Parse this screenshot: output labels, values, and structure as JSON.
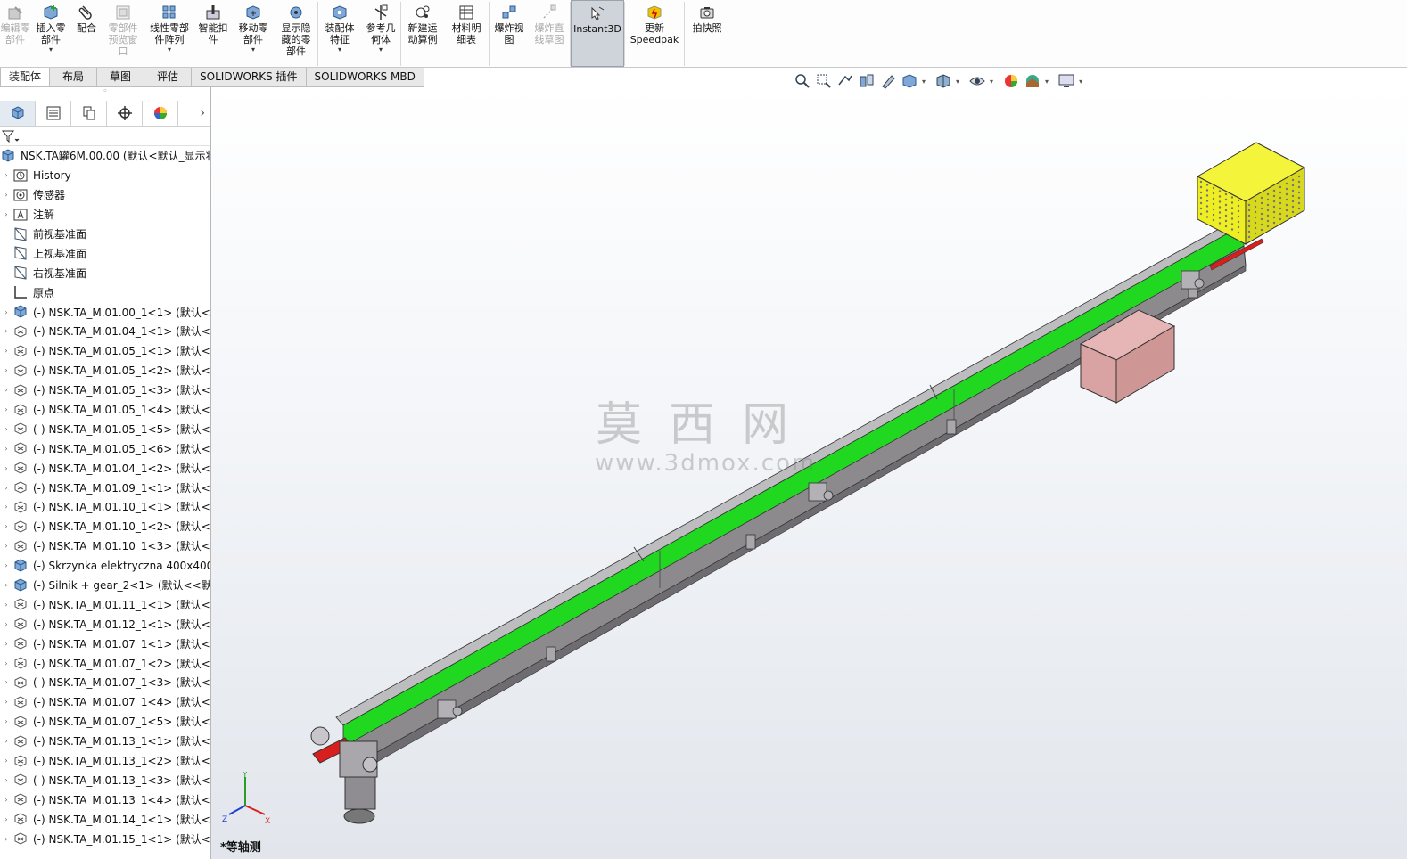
{
  "ribbon": {
    "buttons": [
      {
        "label": "编辑零\n部件",
        "icon": "edit-component-icon",
        "disabled": true,
        "dropdown": false
      },
      {
        "label": "插入零\n部件",
        "icon": "insert-component-icon",
        "disabled": false,
        "dropdown": true
      },
      {
        "label": "配合",
        "icon": "mate-icon",
        "disabled": false,
        "dropdown": false
      },
      {
        "label": "零部件\n预览窗\n口",
        "icon": "component-preview-icon",
        "disabled": true,
        "dropdown": false
      },
      {
        "label": "线性零部\n件阵列",
        "icon": "linear-pattern-icon",
        "disabled": false,
        "dropdown": true
      },
      {
        "label": "智能扣\n件",
        "icon": "smart-fasteners-icon",
        "disabled": false,
        "dropdown": false
      },
      {
        "label": "移动零\n部件",
        "icon": "move-component-icon",
        "disabled": false,
        "dropdown": true
      },
      {
        "label": "显示隐\n藏的零\n部件",
        "icon": "show-hidden-icon",
        "disabled": false,
        "dropdown": false
      },
      {
        "label": "装配体\n特征",
        "icon": "assembly-features-icon",
        "disabled": false,
        "dropdown": true
      },
      {
        "label": "参考几\n何体",
        "icon": "reference-geometry-icon",
        "disabled": false,
        "dropdown": true
      },
      {
        "label": "新建运\n动算例",
        "icon": "new-motion-study-icon",
        "disabled": false,
        "dropdown": false
      },
      {
        "label": "材料明\n细表",
        "icon": "bill-of-materials-icon",
        "disabled": false,
        "dropdown": false
      },
      {
        "label": "爆炸视\n图",
        "icon": "exploded-view-icon",
        "disabled": false,
        "dropdown": false
      },
      {
        "label": "爆炸直\n线草图",
        "icon": "explode-line-sketch-icon",
        "disabled": true,
        "dropdown": false
      },
      {
        "label": "Instant3D",
        "icon": "instant3d-icon",
        "disabled": false,
        "dropdown": false,
        "active": true
      },
      {
        "label": "更新\nSpeedpak",
        "icon": "speedpak-icon",
        "disabled": false,
        "dropdown": false
      },
      {
        "label": "拍快照",
        "icon": "snapshot-icon",
        "disabled": false,
        "dropdown": false
      }
    ]
  },
  "tabs": [
    "装配体",
    "布局",
    "草图",
    "评估",
    "SOLIDWORKS 插件",
    "SOLIDWORKS MBD"
  ],
  "hud_icons": [
    "zoom-to-fit-icon",
    "zoom-to-area-icon",
    "previous-view-icon",
    "section-view-icon",
    "dynamic-annotation-icon",
    "view-orientation-icon",
    "display-style-icon",
    "hide-show-icon",
    "edit-appearance-icon",
    "apply-scene-icon",
    "view-settings-icon"
  ],
  "tree": {
    "root": "NSK.TA罐6M.00.00  (默认<默认_显示状",
    "folders": [
      {
        "label": "History",
        "icon": "history-icon"
      },
      {
        "label": "传感器",
        "icon": "sensors-icon"
      },
      {
        "label": "注解",
        "icon": "annotations-icon"
      },
      {
        "label": "前视基准面",
        "icon": "plane-icon"
      },
      {
        "label": "上视基准面",
        "icon": "plane-icon"
      },
      {
        "label": "右视基准面",
        "icon": "plane-icon"
      },
      {
        "label": "原点",
        "icon": "origin-icon"
      }
    ],
    "components": [
      "(-) NSK.TA_M.01.00_1<1> (默认<默",
      "(-) NSK.TA_M.01.04_1<1> (默认<<",
      "(-) NSK.TA_M.01.05_1<1> (默认<<",
      "(-) NSK.TA_M.01.05_1<2> (默认<<",
      "(-) NSK.TA_M.01.05_1<3> (默认<<",
      "(-) NSK.TA_M.01.05_1<4> (默认<<",
      "(-) NSK.TA_M.01.05_1<5> (默认<<",
      "(-) NSK.TA_M.01.05_1<6> (默认<<",
      "(-) NSK.TA_M.01.04_1<2> (默认<<",
      "(-) NSK.TA_M.01.09_1<1> (默认<<",
      "(-) NSK.TA_M.01.10_1<1> (默认<<",
      "(-) NSK.TA_M.01.10_1<2> (默认<<",
      "(-) NSK.TA_M.01.10_1<3> (默认<<",
      "(-) Skrzynka elektryczna 400x400x",
      "(-) Silnik + gear_2<1> (默认<<默认",
      "(-) NSK.TA_M.01.11_1<1> (默认<<",
      "(-) NSK.TA_M.01.12_1<1> (默认<<",
      "(-) NSK.TA_M.01.07_1<1> (默认<<",
      "(-) NSK.TA_M.01.07_1<2> (默认<<",
      "(-) NSK.TA_M.01.07_1<3> (默认<<",
      "(-) NSK.TA_M.01.07_1<4> (默认<<",
      "(-) NSK.TA_M.01.07_1<5> (默认<<",
      "(-) NSK.TA_M.01.13_1<1> (默认<<",
      "(-) NSK.TA_M.01.13_1<2> (默认<<",
      "(-) NSK.TA_M.01.13_1<3> (默认<<",
      "(-) NSK.TA_M.01.13_1<4> (默认<<",
      "(-) NSK.TA_M.01.14_1<1> (默认<<",
      "(-) NSK.TA_M.01.15_1<1> (默认<<"
    ]
  },
  "viewport": {
    "watermark_cn": "莫西网",
    "watermark_url": "www.3dmox.com",
    "view_label": "*等轴测",
    "triad": {
      "x": "X",
      "y": "Y",
      "z": "Z"
    },
    "colors": {
      "belt": "#1fd81f",
      "frame": "#8c8a8d",
      "cover": "#eeee22",
      "cabinet": "#d9a3a3",
      "accent_red": "#d91e1e"
    }
  }
}
